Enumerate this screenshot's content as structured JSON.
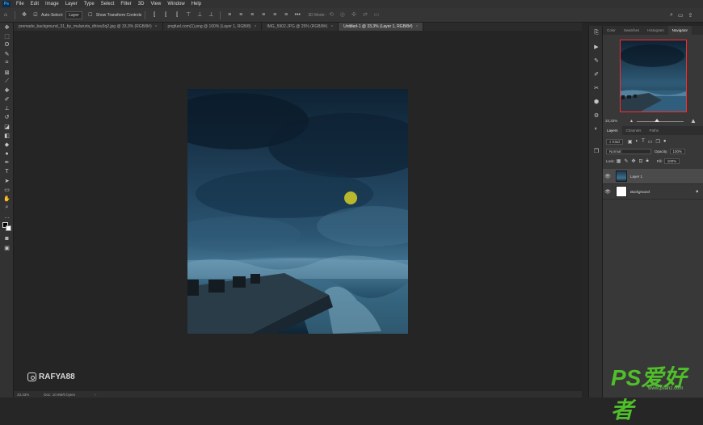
{
  "menu": {
    "logo": "Ps",
    "items": [
      "File",
      "Edit",
      "Image",
      "Layer",
      "Type",
      "Select",
      "Filter",
      "3D",
      "View",
      "Window",
      "Help"
    ]
  },
  "options": {
    "auto_select_label": "Auto-Select:",
    "auto_select_value": "Layer",
    "transform_label": "Show Transform Controls",
    "mode_3d_label": "3D Mode:"
  },
  "tabs": [
    {
      "label": "premade_background_31_by_mulanzta_dhivw3q2.jpg @ 33,3% (RGB/8#)",
      "active": false
    },
    {
      "label": "pngfuel.com(1).png @ 100% (Layer 1, RGB/8)",
      "active": false
    },
    {
      "label": "IMG_5902.JPG @ 25% (RGB/8#)",
      "active": false
    },
    {
      "label": "Untitled-1 @ 33,3% (Layer 1, RGB/8#)",
      "active": true
    }
  ],
  "status": {
    "zoom": "33.33%",
    "doc": "Doc: 10.9M/0 bytes"
  },
  "watermark": "RAFYA88",
  "panel": {
    "top_tabs": [
      "Color",
      "Swatches",
      "Histogram",
      "Navigator"
    ],
    "nav_zoom": "33,33%",
    "layer_tabs": [
      "Layers",
      "Channels",
      "Paths"
    ],
    "kind_label": "Kind",
    "blend_mode": "Normal",
    "opacity_label": "Opacity:",
    "opacity_value": "100%",
    "lock_label": "Lock:",
    "fill_label": "Fill:",
    "fill_value": "100%",
    "layers": [
      {
        "name": "Layer 1",
        "selected": true
      },
      {
        "name": "Background",
        "selected": false
      }
    ]
  },
  "site_mark": {
    "logo": "PS爱好者",
    "url": "www.psahz.com"
  },
  "colors": {
    "ps_blue": "#31a8ff",
    "nav_red": "#ff2a2a",
    "cursor_yellow": "#d6ce28"
  }
}
